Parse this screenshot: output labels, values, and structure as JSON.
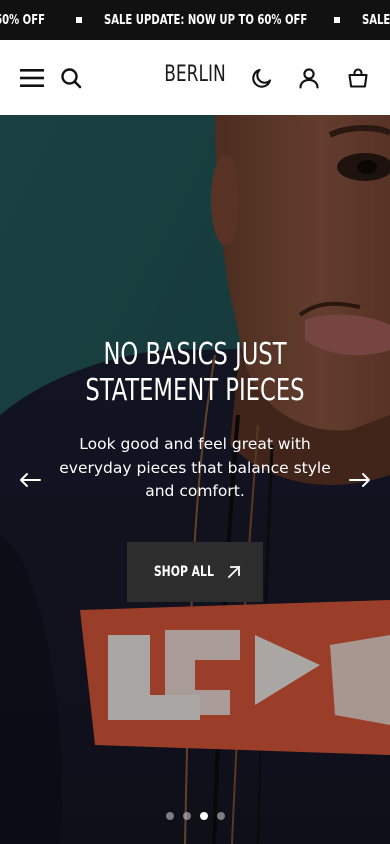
{
  "announcement": {
    "items": [
      "SALE UPDATE: NOW UP TO 60% OFF",
      "SALE UPDATE: NOW UP TO 60% OFF",
      "SALE UPDATE: NOW UP TO 60% OFF"
    ]
  },
  "header": {
    "logo": "BERLIN",
    "icons": {
      "menu": "hamburger-menu-icon",
      "search": "search-icon",
      "theme": "moon-icon",
      "account": "user-icon",
      "cart": "shopping-bag-icon"
    }
  },
  "hero": {
    "title_line1": "NO BASICS JUST",
    "title_line2": "STATEMENT PIECES",
    "subtitle": "Look good and feel great with everyday pieces that balance style and comfort.",
    "button_label": "SHOP ALL",
    "button_icon": "arrow-up-right-icon",
    "prev_icon": "arrow-left-icon",
    "next_icon": "arrow-right-icon",
    "slide_count": 4,
    "active_slide": 3
  },
  "colors": {
    "announcement_bg": "#111111",
    "button_bg": "#2d2d2d",
    "text_dark": "#1a1a1a"
  }
}
